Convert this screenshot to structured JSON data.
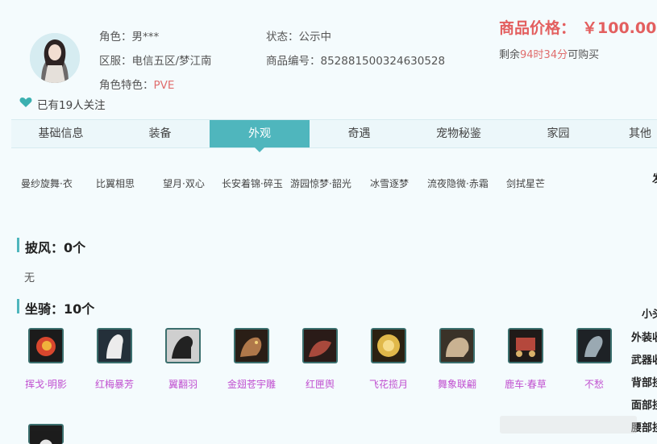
{
  "profile": {
    "role_label": "角色：",
    "role_value": "男***",
    "server_label": "区服：",
    "server_value": "电信五区/梦江南",
    "feature_label": "角色特色：",
    "feature_value": "PVE",
    "status_label": "状态：",
    "status_value": "公示中",
    "id_label": "商品编号：",
    "id_value": "852881500324630528",
    "follow_text": "已有19人关注"
  },
  "price": {
    "label": "商品价格：",
    "value": "￥100.00",
    "remain_prefix": "剩余",
    "remain_hours": "94时34分",
    "remain_suffix": "可购买"
  },
  "tabs": [
    "基础信息",
    "装备",
    "外观",
    "奇遇",
    "宠物秘鉴",
    "家园",
    "其他"
  ],
  "active_tab": "外观",
  "outfits": [
    "曼纱旋舞·衣",
    "比翼相思",
    "望月·双心",
    "长安着锦·碎玉",
    "游园惊梦·韶光",
    "冰雪逐梦",
    "流夜隐微·赤霜",
    "剑拭星芒"
  ],
  "right_column": [
    "发",
    "",
    "",
    "",
    "",
    "",
    "",
    "小头",
    "外装收",
    "武器收",
    "背部挂",
    "面部挂",
    "腰部挂"
  ],
  "cloak": {
    "title": "披风：0个",
    "empty_text": "无"
  },
  "mounts": {
    "title": "坐骑：10个",
    "items": [
      {
        "name": "挥戈·明影",
        "icon": "phoenix-mount-icon",
        "color": "#d8472e"
      },
      {
        "name": "红梅暴芳",
        "icon": "white-horse-icon",
        "color": "#e8e8e8"
      },
      {
        "name": "翼翻羽",
        "icon": "black-horse-icon",
        "color": "#2a2a2a"
      },
      {
        "name": "金翅苍宇雕",
        "icon": "eagle-icon",
        "color": "#b0784a"
      },
      {
        "name": "红匣舆",
        "icon": "red-beast-icon",
        "color": "#a8493c"
      },
      {
        "name": "飞花揽月",
        "icon": "golden-disc-icon",
        "color": "#e0b84a"
      },
      {
        "name": "舞象联翩",
        "icon": "elephant-icon",
        "color": "#c9b292"
      },
      {
        "name": "鹿车·春草",
        "icon": "deer-cart-icon",
        "color": "#b5483c"
      },
      {
        "name": "不愁",
        "icon": "bird-icon",
        "color": "#9aa9b2"
      }
    ]
  }
}
